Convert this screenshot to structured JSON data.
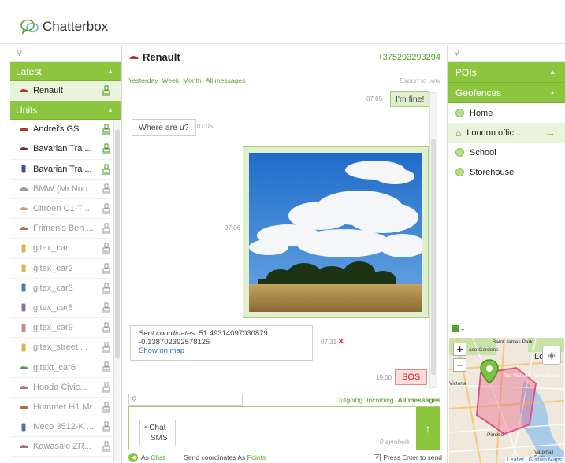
{
  "app": {
    "name": "Chatterbox"
  },
  "left": {
    "search_placeholder": "",
    "latest_label": "Latest",
    "latest_items": [
      {
        "name": "Renault"
      }
    ],
    "units_label": "Units",
    "units": [
      {
        "name": "Andrei's GS",
        "online": true
      },
      {
        "name": "Bavarian Tra ...",
        "online": true
      },
      {
        "name": "Bavarian Tra ...",
        "online": true
      },
      {
        "name": "BMW (Mr.Norr ...",
        "online": false
      },
      {
        "name": "Citroen C1-T ...",
        "online": false
      },
      {
        "name": "Frimen's Ben ...",
        "online": false
      },
      {
        "name": "gitex_car",
        "online": false
      },
      {
        "name": "gitex_car2",
        "online": false
      },
      {
        "name": "gitex_car3",
        "online": false
      },
      {
        "name": "gitex_car8",
        "online": false
      },
      {
        "name": "gitex_car9",
        "online": false
      },
      {
        "name": "gitex_street ...",
        "online": false
      },
      {
        "name": "gitext_car6",
        "online": false
      },
      {
        "name": "Honda Civic...",
        "online": false
      },
      {
        "name": "Hummer H1 Mr ...",
        "online": false
      },
      {
        "name": "Iveco 3512-K ...",
        "online": false
      },
      {
        "name": "Kawasaki ZR...",
        "online": false
      }
    ]
  },
  "chat": {
    "title": "Renault",
    "phone": "+375293293294",
    "filters": [
      "Yesterday",
      "Week",
      "Month",
      "All messages"
    ],
    "export_label": "Export to .xml",
    "messages": {
      "m1": {
        "time": "07:05",
        "text": "I'm fine!"
      },
      "m2": {
        "time": "07:05",
        "text": "Where are u?"
      },
      "m3": {
        "time": "07:06"
      },
      "m4": {
        "time": "07:31",
        "label": "Sent coordinates",
        "coords": ": 51.49314097030879; -0.138702392578125",
        "link": "Show on map"
      },
      "m5": {
        "time": "19:00",
        "text": "SOS"
      }
    },
    "direction_filters": [
      "Outgoing",
      "Incoming",
      "All messages"
    ],
    "compose": {
      "symbols": "0 symbols",
      "modes": [
        "Chat",
        "SMS"
      ]
    },
    "bottom": {
      "as_label": "As",
      "as_value": "Chat",
      "send_coords_label": "Send coordinates As",
      "send_coords_value": "Points",
      "enter_label": "Press Enter to send"
    }
  },
  "right": {
    "pois_label": "POIs",
    "geofences_label": "Geofences",
    "geofences": [
      {
        "name": "Home"
      },
      {
        "name": "London offic ..."
      },
      {
        "name": "School"
      },
      {
        "name": "Storehouse"
      }
    ],
    "map": {
      "labels": {
        "st_james": "Saint James Park",
        "london": "Londo",
        "victoria_tower": "The Victoria Tower Garde",
        "victoria": "Victoria",
        "pimlico": "Pimlico",
        "vauxhall": "Vauxhall Park",
        "gardens": "ace Gardens"
      },
      "attribution": "Leaflet | Gurtam Maps"
    }
  },
  "colors": {
    "accent": "#8cc63f",
    "accent_dark": "#5aa02c",
    "alert": "#d33333"
  }
}
